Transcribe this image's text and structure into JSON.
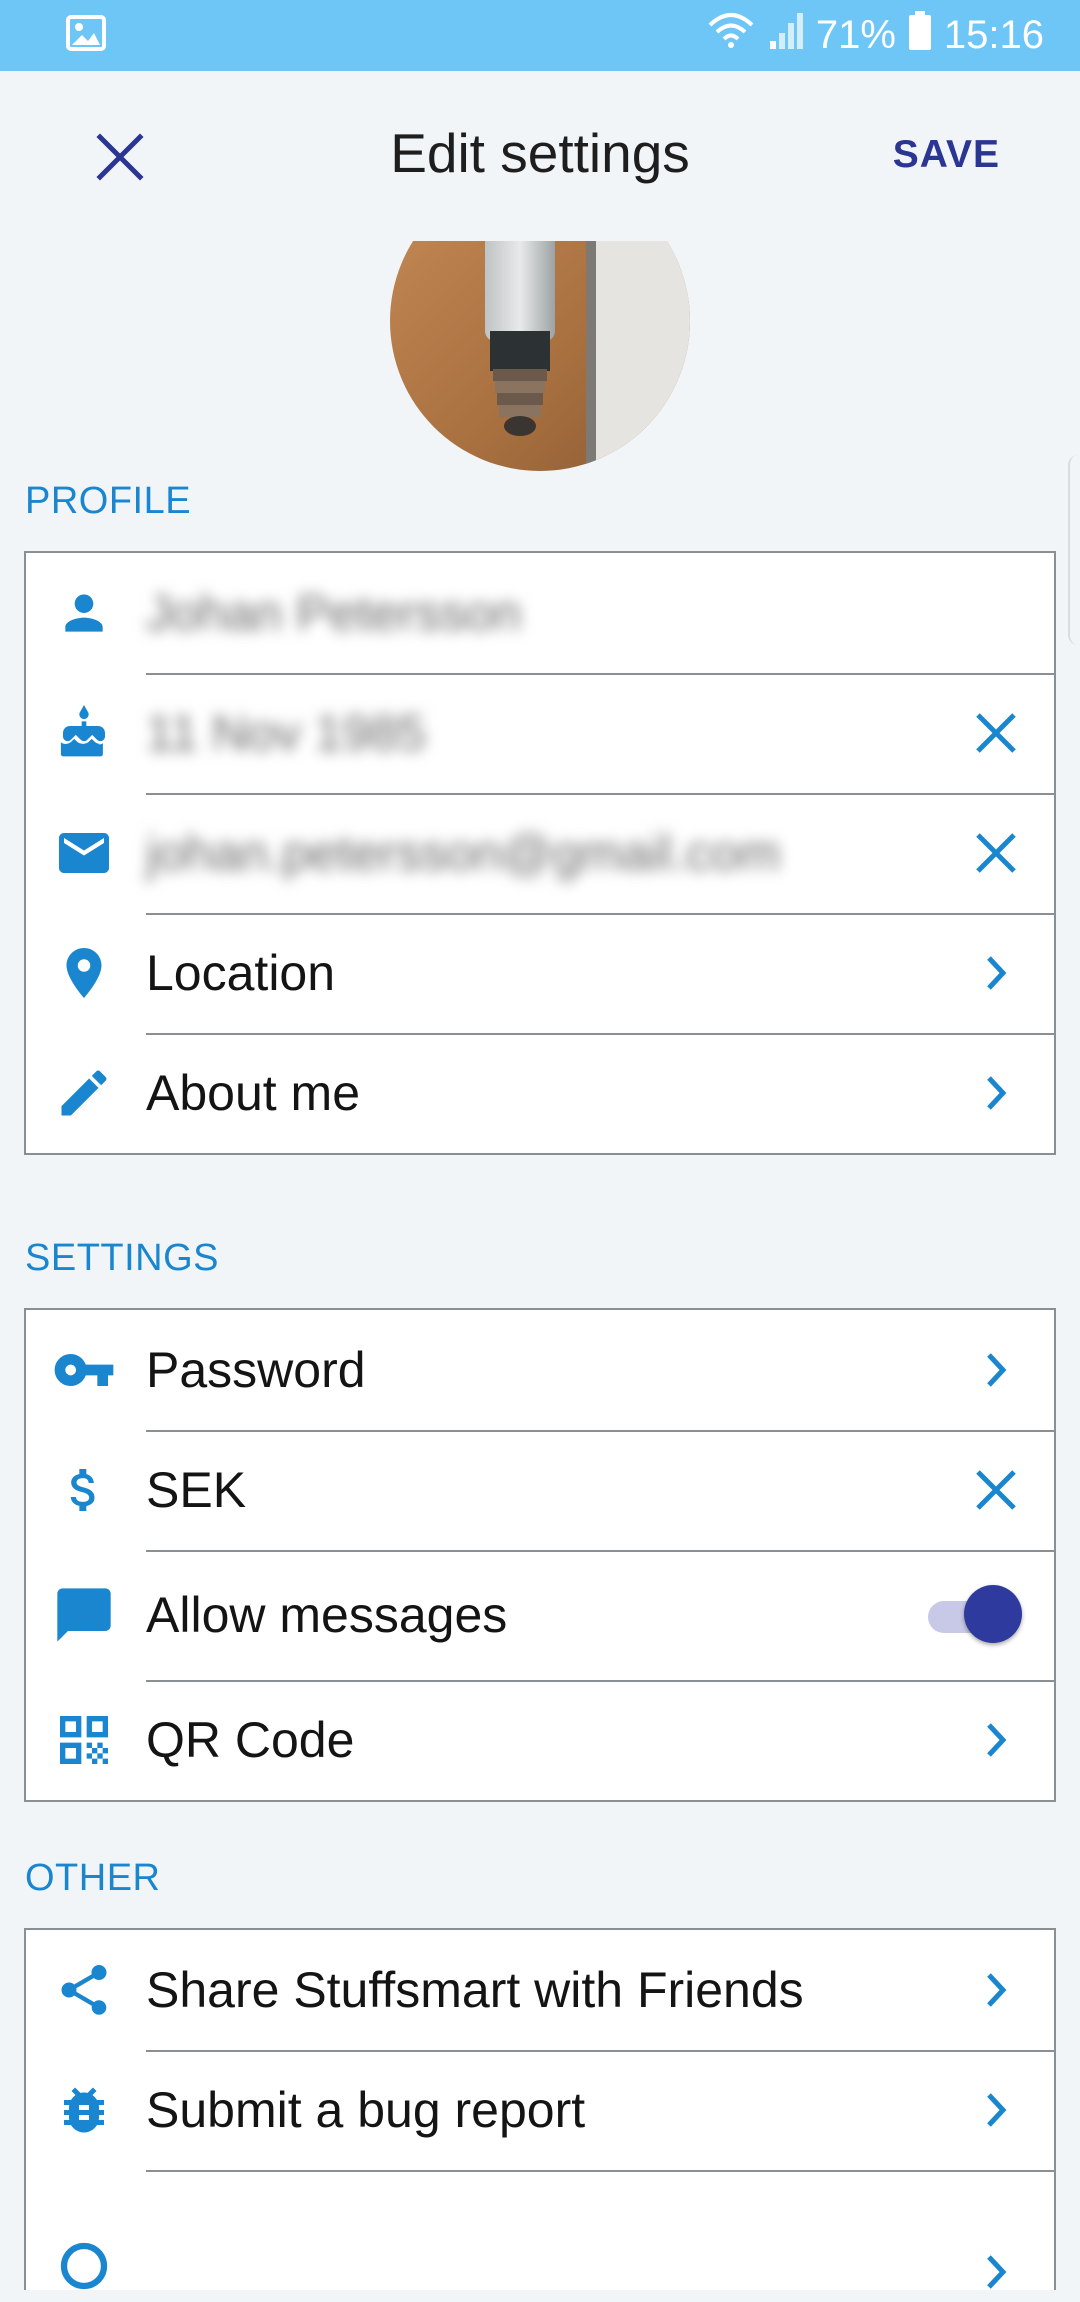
{
  "status_bar": {
    "battery_percent": "71%",
    "time": "15:16",
    "icons": [
      "gallery-icon",
      "wifi-icon",
      "signal-icon",
      "battery-icon"
    ]
  },
  "toolbar": {
    "title": "Edit settings",
    "save_label": "SAVE",
    "close_icon": "close-icon"
  },
  "sections": {
    "profile": {
      "header": "PROFILE",
      "rows": [
        {
          "icon": "person-icon",
          "value": "Johan Petersson",
          "blurred": true,
          "trail": "none"
        },
        {
          "icon": "cake-icon",
          "value": "11 Nov 1985",
          "blurred": true,
          "trail": "clear"
        },
        {
          "icon": "email-icon",
          "value": "johan.petersson@gmail.com",
          "blurred": true,
          "trail": "clear"
        },
        {
          "icon": "location-icon",
          "value": "Location",
          "trail": "chevron"
        },
        {
          "icon": "pencil-icon",
          "value": "About me",
          "trail": "chevron"
        }
      ]
    },
    "settings": {
      "header": "SETTINGS",
      "rows": [
        {
          "icon": "key-icon",
          "value": "Password",
          "trail": "chevron"
        },
        {
          "icon": "dollar-icon",
          "value": "SEK",
          "trail": "clear"
        },
        {
          "icon": "message-icon",
          "value": "Allow messages",
          "trail": "toggle",
          "toggle_on": true
        },
        {
          "icon": "qr-code-icon",
          "value": "QR Code",
          "trail": "chevron"
        }
      ]
    },
    "other": {
      "header": "OTHER",
      "rows": [
        {
          "icon": "share-icon",
          "value": "Share Stuffsmart with Friends",
          "trail": "chevron"
        },
        {
          "icon": "bug-icon",
          "value": "Submit a bug report",
          "trail": "chevron"
        },
        {
          "icon": "help-icon",
          "value": "",
          "trail": "chevron"
        }
      ]
    }
  },
  "colors": {
    "status_bar": "#6ec6f7",
    "accent_blue": "#1a86cf",
    "save_navy": "#2b3592",
    "toggle_thumb": "#2f3a9e",
    "background": "#f2f5f8"
  }
}
